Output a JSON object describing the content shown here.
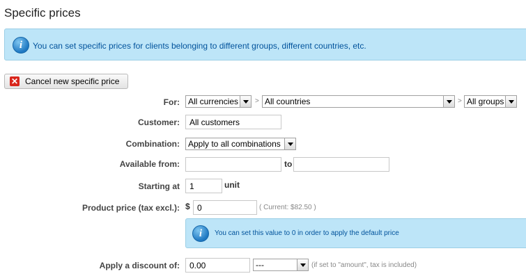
{
  "page": {
    "title": "Specific prices"
  },
  "info_banner": {
    "message": "You can set specific prices for clients belonging to different groups, different countries, etc."
  },
  "cancel_button": {
    "label": "Cancel new specific price"
  },
  "form": {
    "for": {
      "label": "For:",
      "currency": "All currencies",
      "country": "All countries",
      "group": "All groups",
      "separator": ">"
    },
    "customer": {
      "label": "Customer:",
      "value": "All customers"
    },
    "combination": {
      "label": "Combination:",
      "value": "Apply to all combinations"
    },
    "available": {
      "label": "Available from:",
      "from": "",
      "to_label": "to",
      "to": ""
    },
    "starting_at": {
      "label": "Starting at",
      "value": "1",
      "unit": "unit"
    },
    "product_price": {
      "label": "Product price (tax excl.):",
      "currency_symbol": "$",
      "value": "0",
      "current": "( Current: $82.50 )"
    },
    "price_note": {
      "message": "You can set this value to 0 in order to apply the default price"
    },
    "discount": {
      "label": "Apply a discount of:",
      "value": "0.00",
      "type": "---",
      "hint": "(if set to \"amount\", tax is included)"
    }
  }
}
